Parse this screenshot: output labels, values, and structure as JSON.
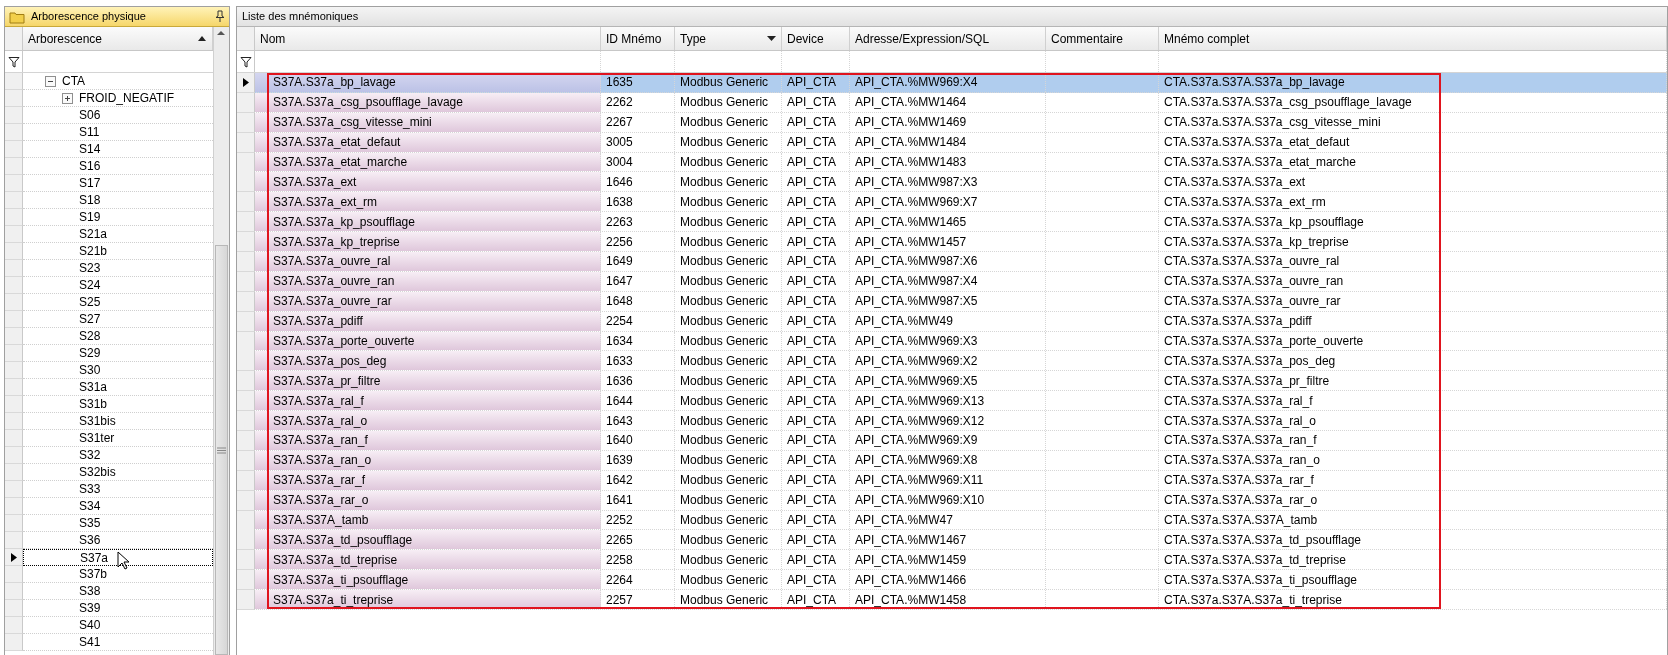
{
  "left_panel": {
    "title": "Arborescence physique",
    "column": {
      "label": "Arborescence"
    },
    "tree": [
      {
        "label": "CTA",
        "expanded": true,
        "selected": false,
        "children": [
          {
            "label": "FROID_NEGATIF",
            "expanded": false,
            "selected": false
          },
          {
            "label": "S06",
            "selected": false
          },
          {
            "label": "S11",
            "selected": false
          },
          {
            "label": "S14",
            "selected": false
          },
          {
            "label": "S16",
            "selected": false
          },
          {
            "label": "S17",
            "selected": false
          },
          {
            "label": "S18",
            "selected": false
          },
          {
            "label": "S19",
            "selected": false
          },
          {
            "label": "S21a",
            "selected": false
          },
          {
            "label": "S21b",
            "selected": false
          },
          {
            "label": "S23",
            "selected": false
          },
          {
            "label": "S24",
            "selected": false
          },
          {
            "label": "S25",
            "selected": false
          },
          {
            "label": "S27",
            "selected": false
          },
          {
            "label": "S28",
            "selected": false
          },
          {
            "label": "S29",
            "selected": false
          },
          {
            "label": "S30",
            "selected": false
          },
          {
            "label": "S31a",
            "selected": false
          },
          {
            "label": "S31b",
            "selected": false
          },
          {
            "label": "S31bis",
            "selected": false
          },
          {
            "label": "S31ter",
            "selected": false
          },
          {
            "label": "S32",
            "selected": false
          },
          {
            "label": "S32bis",
            "selected": false
          },
          {
            "label": "S33",
            "selected": false
          },
          {
            "label": "S34",
            "selected": false
          },
          {
            "label": "S35",
            "selected": false
          },
          {
            "label": "S36",
            "selected": false
          },
          {
            "label": "S37a",
            "selected": true
          },
          {
            "label": "S37b",
            "selected": false
          },
          {
            "label": "S38",
            "selected": false
          },
          {
            "label": "S39",
            "selected": false
          },
          {
            "label": "S40",
            "selected": false
          },
          {
            "label": "S41",
            "selected": false
          }
        ]
      }
    ]
  },
  "right_panel": {
    "title": "Liste des mnémoniques",
    "highlight_frame": true,
    "columns": [
      {
        "label": "Nom",
        "dropdown": false
      },
      {
        "label": "ID Mnémo",
        "dropdown": false
      },
      {
        "label": "Type",
        "dropdown": true
      },
      {
        "label": "Device",
        "dropdown": false
      },
      {
        "label": "Adresse/Expression/SQL",
        "dropdown": false
      },
      {
        "label": "Commentaire",
        "dropdown": false
      },
      {
        "label": "Mnémo complet",
        "dropdown": false
      }
    ],
    "rows": [
      {
        "selected": true,
        "nom": "S37A.S37a_bp_lavage",
        "id_mnemo": "1635",
        "type": "Modbus Generic",
        "device": "API_CTA",
        "adresse": "API_CTA.%MW969:X4",
        "mnemo_complet": "CTA.S37a.S37A.S37a_bp_lavage"
      },
      {
        "selected": false,
        "nom": "S37A.S37a_csg_psoufflage_lavage",
        "id_mnemo": "2262",
        "type": "Modbus Generic",
        "device": "API_CTA",
        "adresse": "API_CTA.%MW1464",
        "mnemo_complet": "CTA.S37a.S37A.S37a_csg_psoufflage_lavage"
      },
      {
        "selected": false,
        "nom": "S37A.S37a_csg_vitesse_mini",
        "id_mnemo": "2267",
        "type": "Modbus Generic",
        "device": "API_CTA",
        "adresse": "API_CTA.%MW1469",
        "mnemo_complet": "CTA.S37a.S37A.S37a_csg_vitesse_mini"
      },
      {
        "selected": false,
        "nom": "S37A.S37a_etat_defaut",
        "id_mnemo": "3005",
        "type": "Modbus Generic",
        "device": "API_CTA",
        "adresse": "API_CTA.%MW1484",
        "mnemo_complet": "CTA.S37a.S37A.S37a_etat_defaut"
      },
      {
        "selected": false,
        "nom": "S37A.S37a_etat_marche",
        "id_mnemo": "3004",
        "type": "Modbus Generic",
        "device": "API_CTA",
        "adresse": "API_CTA.%MW1483",
        "mnemo_complet": "CTA.S37a.S37A.S37a_etat_marche"
      },
      {
        "selected": false,
        "nom": "S37A.S37a_ext",
        "id_mnemo": "1646",
        "type": "Modbus Generic",
        "device": "API_CTA",
        "adresse": "API_CTA.%MW987:X3",
        "mnemo_complet": "CTA.S37a.S37A.S37a_ext"
      },
      {
        "selected": false,
        "nom": "S37A.S37a_ext_rm",
        "id_mnemo": "1638",
        "type": "Modbus Generic",
        "device": "API_CTA",
        "adresse": "API_CTA.%MW969:X7",
        "mnemo_complet": "CTA.S37a.S37A.S37a_ext_rm"
      },
      {
        "selected": false,
        "nom": "S37A.S37a_kp_psoufflage",
        "id_mnemo": "2263",
        "type": "Modbus Generic",
        "device": "API_CTA",
        "adresse": "API_CTA.%MW1465",
        "mnemo_complet": "CTA.S37a.S37A.S37a_kp_psoufflage"
      },
      {
        "selected": false,
        "nom": "S37A.S37a_kp_treprise",
        "id_mnemo": "2256",
        "type": "Modbus Generic",
        "device": "API_CTA",
        "adresse": "API_CTA.%MW1457",
        "mnemo_complet": "CTA.S37a.S37A.S37a_kp_treprise"
      },
      {
        "selected": false,
        "nom": "S37A.S37a_ouvre_ral",
        "id_mnemo": "1649",
        "type": "Modbus Generic",
        "device": "API_CTA",
        "adresse": "API_CTA.%MW987:X6",
        "mnemo_complet": "CTA.S37a.S37A.S37a_ouvre_ral"
      },
      {
        "selected": false,
        "nom": "S37A.S37a_ouvre_ran",
        "id_mnemo": "1647",
        "type": "Modbus Generic",
        "device": "API_CTA",
        "adresse": "API_CTA.%MW987:X4",
        "mnemo_complet": "CTA.S37a.S37A.S37a_ouvre_ran"
      },
      {
        "selected": false,
        "nom": "S37A.S37a_ouvre_rar",
        "id_mnemo": "1648",
        "type": "Modbus Generic",
        "device": "API_CTA",
        "adresse": "API_CTA.%MW987:X5",
        "mnemo_complet": "CTA.S37a.S37A.S37a_ouvre_rar"
      },
      {
        "selected": false,
        "nom": "S37A.S37a_pdiff",
        "id_mnemo": "2254",
        "type": "Modbus Generic",
        "device": "API_CTA",
        "adresse": "API_CTA.%MW49",
        "mnemo_complet": "CTA.S37a.S37A.S37a_pdiff"
      },
      {
        "selected": false,
        "nom": "S37A.S37a_porte_ouverte",
        "id_mnemo": "1634",
        "type": "Modbus Generic",
        "device": "API_CTA",
        "adresse": "API_CTA.%MW969:X3",
        "mnemo_complet": "CTA.S37a.S37A.S37a_porte_ouverte"
      },
      {
        "selected": false,
        "nom": "S37A.S37a_pos_deg",
        "id_mnemo": "1633",
        "type": "Modbus Generic",
        "device": "API_CTA",
        "adresse": "API_CTA.%MW969:X2",
        "mnemo_complet": "CTA.S37a.S37A.S37a_pos_deg"
      },
      {
        "selected": false,
        "nom": "S37A.S37a_pr_filtre",
        "id_mnemo": "1636",
        "type": "Modbus Generic",
        "device": "API_CTA",
        "adresse": "API_CTA.%MW969:X5",
        "mnemo_complet": "CTA.S37a.S37A.S37a_pr_filtre"
      },
      {
        "selected": false,
        "nom": "S37A.S37a_ral_f",
        "id_mnemo": "1644",
        "type": "Modbus Generic",
        "device": "API_CTA",
        "adresse": "API_CTA.%MW969:X13",
        "mnemo_complet": "CTA.S37a.S37A.S37a_ral_f"
      },
      {
        "selected": false,
        "nom": "S37A.S37a_ral_o",
        "id_mnemo": "1643",
        "type": "Modbus Generic",
        "device": "API_CTA",
        "adresse": "API_CTA.%MW969:X12",
        "mnemo_complet": "CTA.S37a.S37A.S37a_ral_o"
      },
      {
        "selected": false,
        "nom": "S37A.S37a_ran_f",
        "id_mnemo": "1640",
        "type": "Modbus Generic",
        "device": "API_CTA",
        "adresse": "API_CTA.%MW969:X9",
        "mnemo_complet": "CTA.S37a.S37A.S37a_ran_f"
      },
      {
        "selected": false,
        "nom": "S37A.S37a_ran_o",
        "id_mnemo": "1639",
        "type": "Modbus Generic",
        "device": "API_CTA",
        "adresse": "API_CTA.%MW969:X8",
        "mnemo_complet": "CTA.S37a.S37A.S37a_ran_o"
      },
      {
        "selected": false,
        "nom": "S37A.S37a_rar_f",
        "id_mnemo": "1642",
        "type": "Modbus Generic",
        "device": "API_CTA",
        "adresse": "API_CTA.%MW969:X11",
        "mnemo_complet": "CTA.S37a.S37A.S37a_rar_f"
      },
      {
        "selected": false,
        "nom": "S37A.S37a_rar_o",
        "id_mnemo": "1641",
        "type": "Modbus Generic",
        "device": "API_CTA",
        "adresse": "API_CTA.%MW969:X10",
        "mnemo_complet": "CTA.S37a.S37A.S37a_rar_o"
      },
      {
        "selected": false,
        "nom": "S37A.S37A_tamb",
        "id_mnemo": "2252",
        "type": "Modbus Generic",
        "device": "API_CTA",
        "adresse": "API_CTA.%MW47",
        "mnemo_complet": "CTA.S37a.S37A.S37A_tamb"
      },
      {
        "selected": false,
        "nom": "S37A.S37a_td_psoufflage",
        "id_mnemo": "2265",
        "type": "Modbus Generic",
        "device": "API_CTA",
        "adresse": "API_CTA.%MW1467",
        "mnemo_complet": "CTA.S37a.S37A.S37a_td_psoufflage"
      },
      {
        "selected": false,
        "nom": "S37A.S37a_td_treprise",
        "id_mnemo": "2258",
        "type": "Modbus Generic",
        "device": "API_CTA",
        "adresse": "API_CTA.%MW1459",
        "mnemo_complet": "CTA.S37a.S37A.S37a_td_treprise"
      },
      {
        "selected": false,
        "nom": "S37A.S37a_ti_psoufflage",
        "id_mnemo": "2264",
        "type": "Modbus Generic",
        "device": "API_CTA",
        "adresse": "API_CTA.%MW1466",
        "mnemo_complet": "CTA.S37a.S37A.S37a_ti_psoufflage"
      },
      {
        "selected": false,
        "nom": "S37A.S37a_ti_treprise",
        "id_mnemo": "2257",
        "type": "Modbus Generic",
        "device": "API_CTA",
        "adresse": "API_CTA.%MW1458",
        "mnemo_complet": "CTA.S37a.S37A.S37a_ti_treprise"
      }
    ]
  }
}
